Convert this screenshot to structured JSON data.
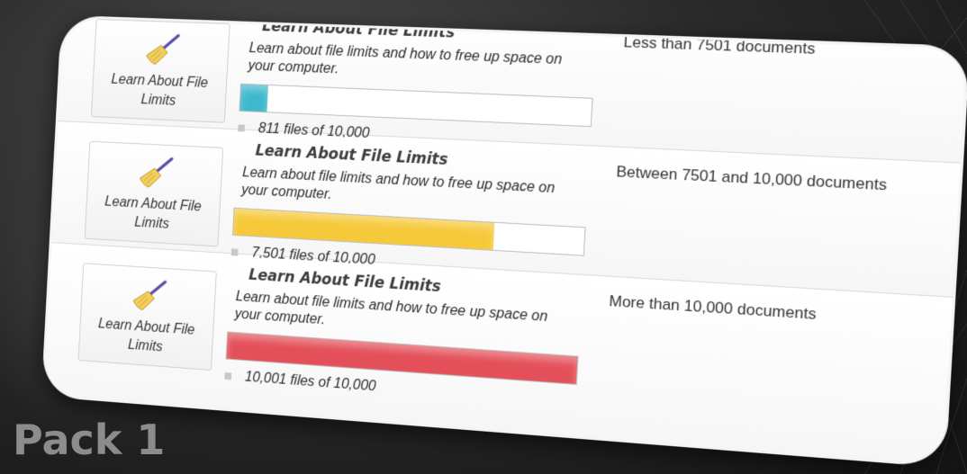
{
  "heading": "Pack 1",
  "colors": {
    "teal_fill": "#3fb8cc",
    "yellow_fill": "#f6c93b",
    "red_fill": "#e4505a"
  },
  "rows": [
    {
      "icon": "broom-icon",
      "tile_label": "Learn About File Limits",
      "title": "Learn About File Limits",
      "description": "Learn about file limits and how to free up space on your computer.",
      "files_used": 811,
      "files_limit": 10000,
      "count_text": "811 files of 10,000",
      "range_text": "Less than 7501 documents",
      "bar_color": "#3fb8cc"
    },
    {
      "icon": "broom-icon",
      "tile_label": "Learn About File Limits",
      "title": "Learn About File Limits",
      "description": "Learn about file limits and how to free up space on your computer.",
      "files_used": 7501,
      "files_limit": 10000,
      "count_text": "7,501 files of 10,000",
      "range_text": "Between 7501 and 10,000 documents",
      "bar_color": "#f6c93b"
    },
    {
      "icon": "broom-icon",
      "tile_label": "Learn About File Limits",
      "title": "Learn About File Limits",
      "description": "Learn about file limits and how to free up space on your computer.",
      "files_used": 10001,
      "files_limit": 10000,
      "count_text": "10,001 files of 10,000",
      "range_text": "More than 10,000 documents",
      "bar_color": "#e4505a"
    }
  ]
}
